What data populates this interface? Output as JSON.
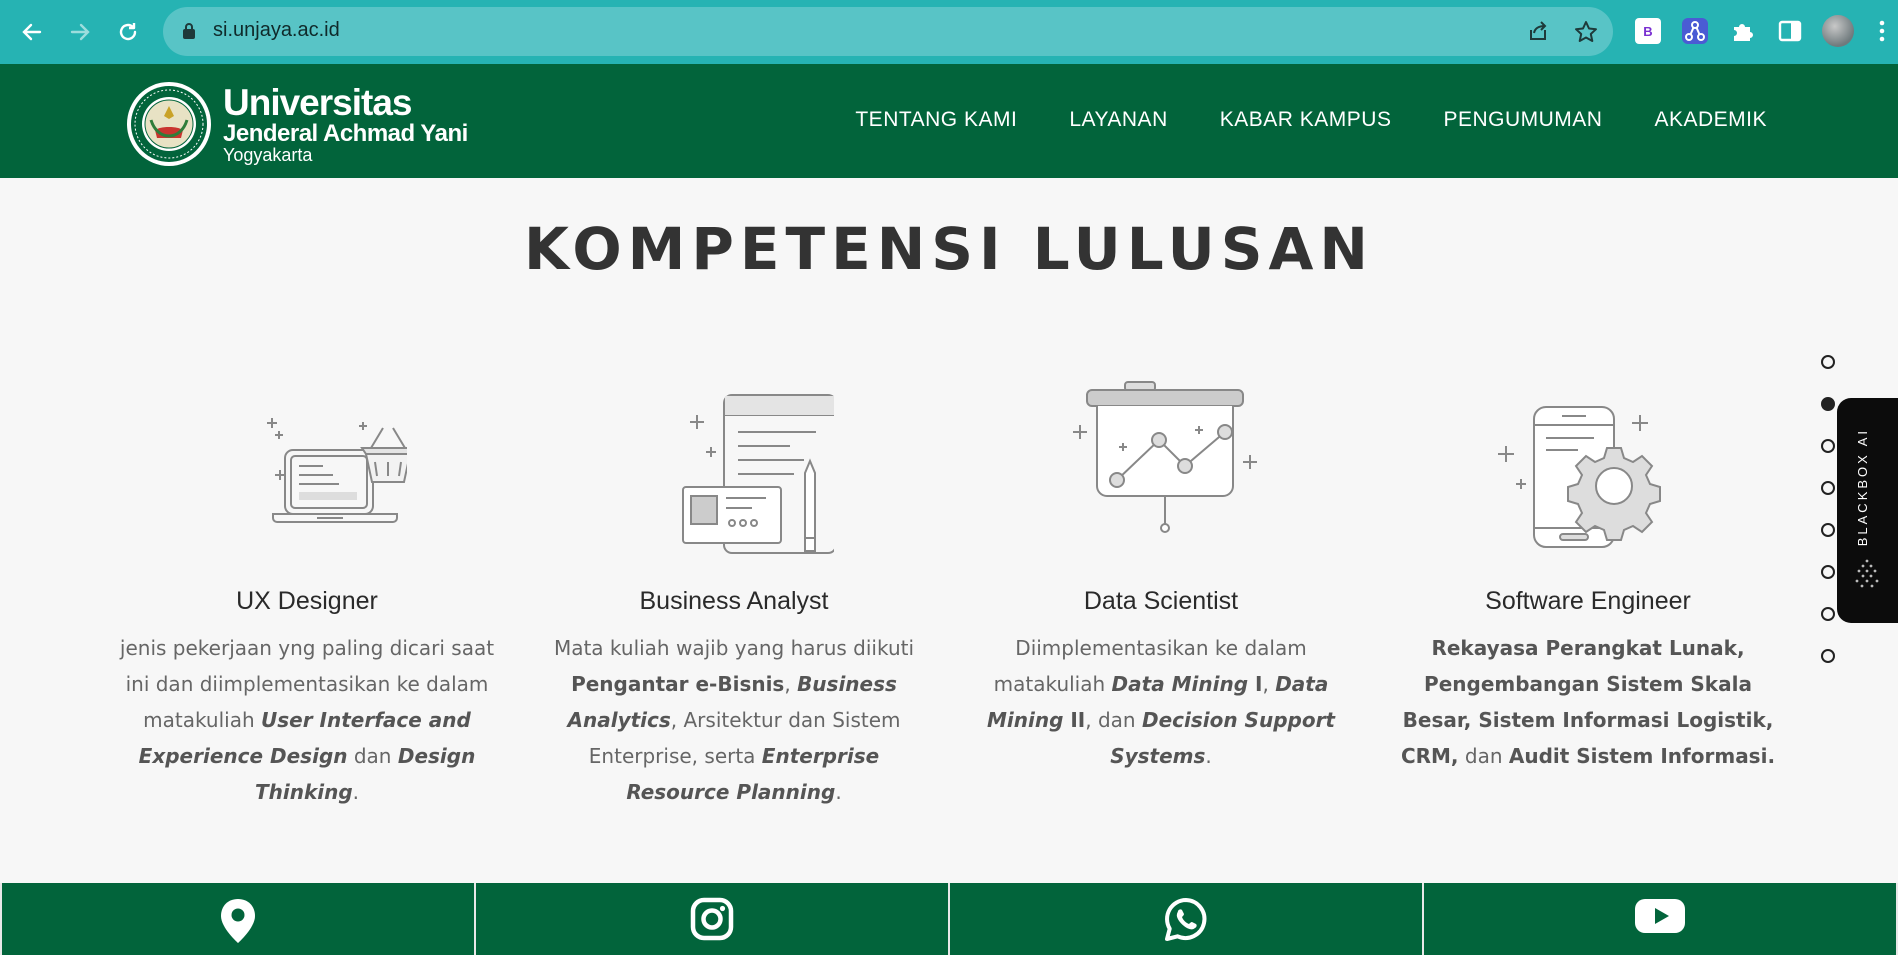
{
  "browser": {
    "url": "si.unjaya.ac.id",
    "extension_b_label": "B"
  },
  "site": {
    "logo": {
      "line1": "Universitas",
      "line2": "Jenderal Achmad Yani",
      "line3": "Yogyakarta"
    },
    "nav": [
      "TENTANG KAMI",
      "LAYANAN",
      "KABAR KAMPUS",
      "PENGUMUMAN",
      "AKADEMIK"
    ]
  },
  "section": {
    "title": "KOMPETENSI LULUSAN",
    "cards": [
      {
        "title": "UX Designer",
        "icon": "laptop-basket-icon",
        "description_parts": [
          {
            "t": "jenis pekerjaan yng paling dicari saat ini dan diimplementasikan ke dalam matakuliah ",
            "s": "normal"
          },
          {
            "t": "User Interface and Experience Design",
            "s": "bold-italic"
          },
          {
            "t": " dan ",
            "s": "normal"
          },
          {
            "t": "Design Thinking",
            "s": "bold-italic"
          },
          {
            "t": ".",
            "s": "normal"
          }
        ]
      },
      {
        "title": "Business Analyst",
        "icon": "document-card-pen-icon",
        "description_parts": [
          {
            "t": "Mata kuliah wajib yang harus diikuti ",
            "s": "normal"
          },
          {
            "t": "Pengantar e-Bisnis",
            "s": "bold"
          },
          {
            "t": ", ",
            "s": "normal"
          },
          {
            "t": "Business Analytics",
            "s": "bold-italic"
          },
          {
            "t": ", Arsitektur dan Sistem Enterprise, serta ",
            "s": "normal"
          },
          {
            "t": "Enterprise Resource Planning",
            "s": "bold-italic"
          },
          {
            "t": ".",
            "s": "normal"
          }
        ]
      },
      {
        "title": "Data Scientist",
        "icon": "presentation-chart-icon",
        "description_parts": [
          {
            "t": "Diimplementasikan ke dalam matakuliah ",
            "s": "normal"
          },
          {
            "t": "Data Mining",
            "s": "bold-italic"
          },
          {
            "t": " I",
            "s": "bold"
          },
          {
            "t": ", ",
            "s": "normal"
          },
          {
            "t": "Data Mining",
            "s": "bold-italic"
          },
          {
            "t": " II",
            "s": "bold"
          },
          {
            "t": ", dan ",
            "s": "normal"
          },
          {
            "t": "Decision Support Systems",
            "s": "bold-italic"
          },
          {
            "t": ".",
            "s": "normal"
          }
        ]
      },
      {
        "title": "Software Engineer",
        "icon": "phone-gear-icon",
        "description_parts": [
          {
            "t": "Rekayasa Perangkat Lunak, Pengembangan Sistem Skala Besar, Sistem Informasi Logistik, CRM,",
            "s": "bold"
          },
          {
            "t": " dan ",
            "s": "normal"
          },
          {
            "t": "Audit Sistem Informasi.",
            "s": "bold"
          }
        ]
      }
    ]
  },
  "dot_nav": {
    "count": 8,
    "active_index": 1
  },
  "blackbox": {
    "label": "BLACKBOX AI"
  },
  "footer_icons": [
    "location-pin-icon",
    "instagram-icon",
    "whatsapp-icon",
    "youtube-icon"
  ],
  "colors": {
    "browser_bar": "#26b3b3",
    "brand_green": "#02643b",
    "heading": "#333333",
    "body_text": "#666666"
  }
}
